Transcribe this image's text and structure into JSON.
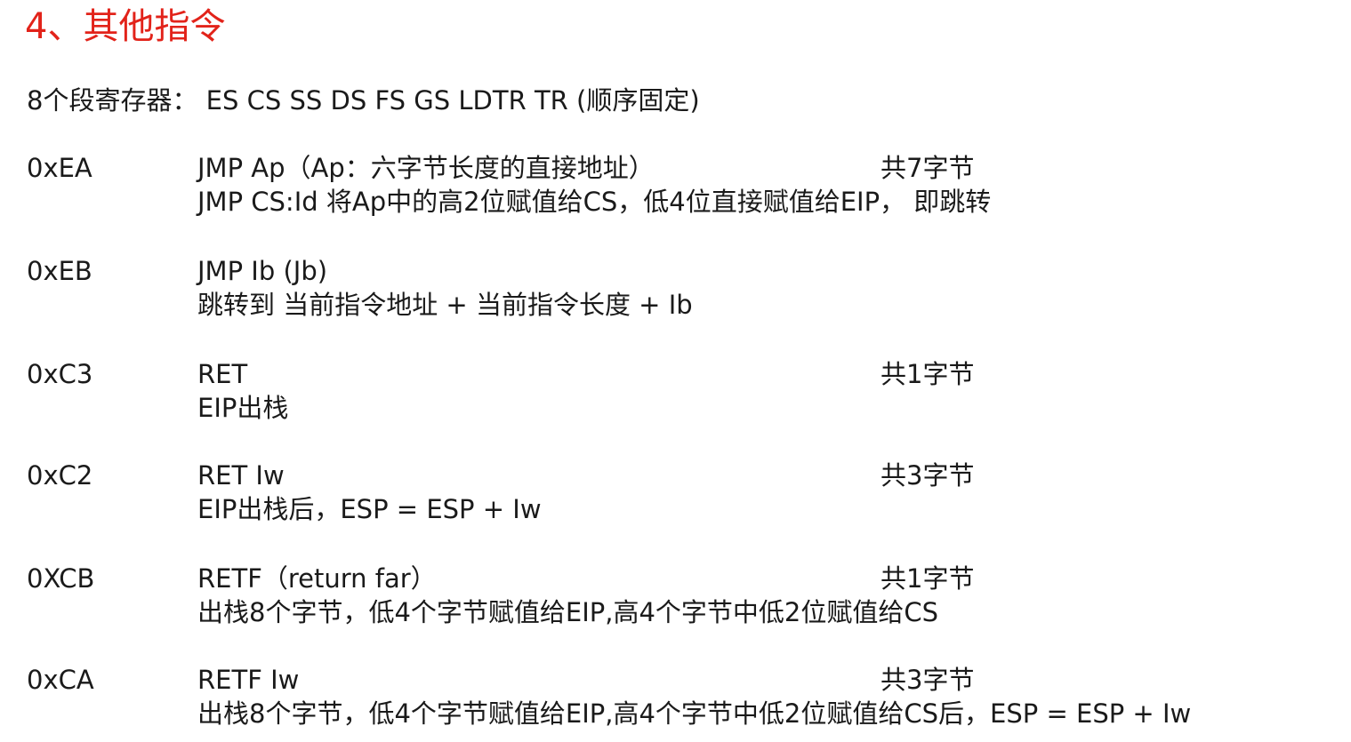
{
  "title": "4、其他指令",
  "segment_registers": "8个段寄存器： ES CS SS DS FS GS LDTR TR (顺序固定)",
  "instructions": [
    {
      "opcode": "0xEA",
      "mnemonic": "JMP Ap（Ap：六字节长度的直接地址）",
      "bytes": "共7字节",
      "desc": "JMP CS:Id 将Ap中的高2位赋值给CS，低4位直接赋值给EIP， 即跳转"
    },
    {
      "opcode": "0xEB",
      "mnemonic": "JMP Ib (Jb)",
      "bytes": "",
      "desc": "跳转到 当前指令地址 + 当前指令长度 + Ib"
    },
    {
      "opcode": "0xC3",
      "mnemonic": "RET",
      "bytes": "共1字节",
      "desc": "EIP出栈"
    },
    {
      "opcode": "0xC2",
      "mnemonic": "RET Iw",
      "bytes": "共3字节",
      "desc": "EIP出栈后，ESP = ESP + Iw"
    },
    {
      "opcode": "0XCB",
      "mnemonic": "RETF（return far）",
      "bytes": "共1字节",
      "desc": "出栈8个字节，低4个字节赋值给EIP,高4个字节中低2位赋值给CS"
    },
    {
      "opcode": "0xCA",
      "mnemonic": "RETF Iw",
      "bytes": "共3字节",
      "desc": "出栈8个字节，低4个字节赋值给EIP,高4个字节中低2位赋值给CS后，ESP = ESP + Iw"
    }
  ]
}
